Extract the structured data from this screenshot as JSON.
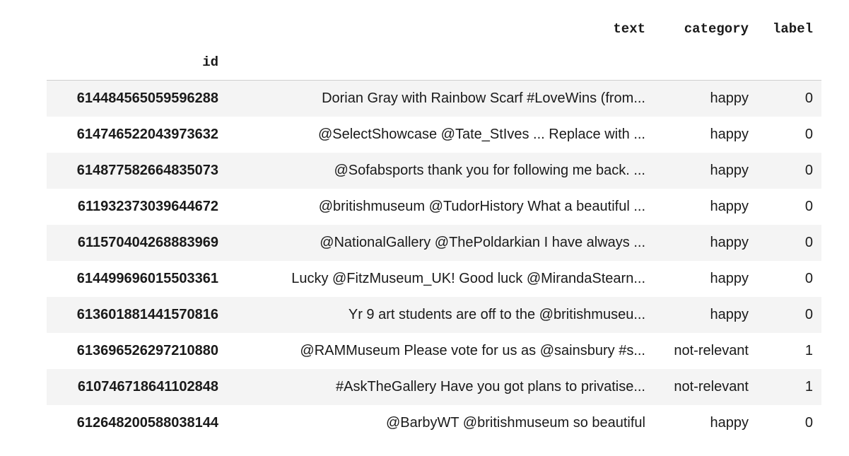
{
  "dataframe": {
    "columns": [
      "text",
      "category",
      "label"
    ],
    "index_name": "id",
    "rows": [
      {
        "id": "614484565059596288",
        "text": "Dorian Gray with Rainbow Scarf #LoveWins (from...",
        "category": "happy",
        "label": "0"
      },
      {
        "id": "614746522043973632",
        "text": "@SelectShowcase @Tate_StIves ... Replace with ...",
        "category": "happy",
        "label": "0"
      },
      {
        "id": "614877582664835073",
        "text": "@Sofabsports thank you for following me back. ...",
        "category": "happy",
        "label": "0"
      },
      {
        "id": "611932373039644672",
        "text": "@britishmuseum @TudorHistory What a beautiful ...",
        "category": "happy",
        "label": "0"
      },
      {
        "id": "611570404268883969",
        "text": "@NationalGallery @ThePoldarkian I have always ...",
        "category": "happy",
        "label": "0"
      },
      {
        "id": "614499696015503361",
        "text": "Lucky @FitzMuseum_UK! Good luck @MirandaStearn...",
        "category": "happy",
        "label": "0"
      },
      {
        "id": "613601881441570816",
        "text": "Yr 9 art students are off to the @britishmuseu...",
        "category": "happy",
        "label": "0"
      },
      {
        "id": "613696526297210880",
        "text": "@RAMMuseum Please vote for us as @sainsbury #s...",
        "category": "not-relevant",
        "label": "1"
      },
      {
        "id": "610746718641102848",
        "text": "#AskTheGallery Have you got plans to privatise...",
        "category": "not-relevant",
        "label": "1"
      },
      {
        "id": "612648200588038144",
        "text": "@BarbyWT @britishmuseum so beautiful",
        "category": "happy",
        "label": "0"
      }
    ]
  }
}
